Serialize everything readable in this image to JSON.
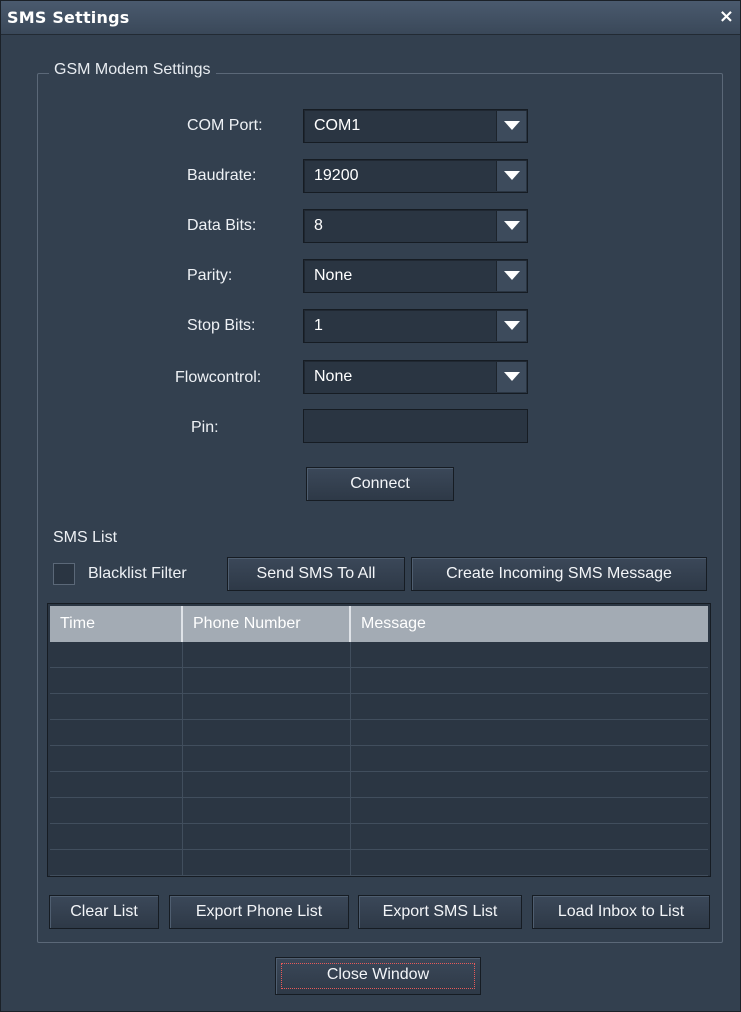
{
  "window": {
    "title": "SMS Settings",
    "close_glyph": "×"
  },
  "gsm": {
    "legend": "GSM Modem Settings",
    "fields": [
      {
        "label": "COM Port:",
        "value": "COM1"
      },
      {
        "label": "Baudrate:",
        "value": "19200"
      },
      {
        "label": "Data Bits:",
        "value": "8"
      },
      {
        "label": "Parity:",
        "value": "None"
      },
      {
        "label": "Stop Bits:",
        "value": "1"
      },
      {
        "label": "Flowcontrol:",
        "value": "None"
      }
    ],
    "pin_label": "Pin:",
    "pin_value": "",
    "connect_label": "Connect"
  },
  "sms": {
    "title": "SMS List",
    "blacklist_label": "Blacklist Filter",
    "blacklist_checked": false,
    "send_all_label": "Send SMS To All",
    "create_incoming_label": "Create Incoming SMS Message",
    "columns": [
      "Time",
      "Phone Number",
      "Message"
    ],
    "rows": [],
    "buttons": {
      "clear": "Clear List",
      "export_phone": "Export Phone List",
      "export_sms": "Export SMS List",
      "load_inbox": "Load Inbox to List"
    }
  },
  "close_window_label": "Close Window",
  "colors": {
    "background": "#33404f",
    "header": "#a3abb4",
    "focus_outline": "#e65a5a"
  }
}
